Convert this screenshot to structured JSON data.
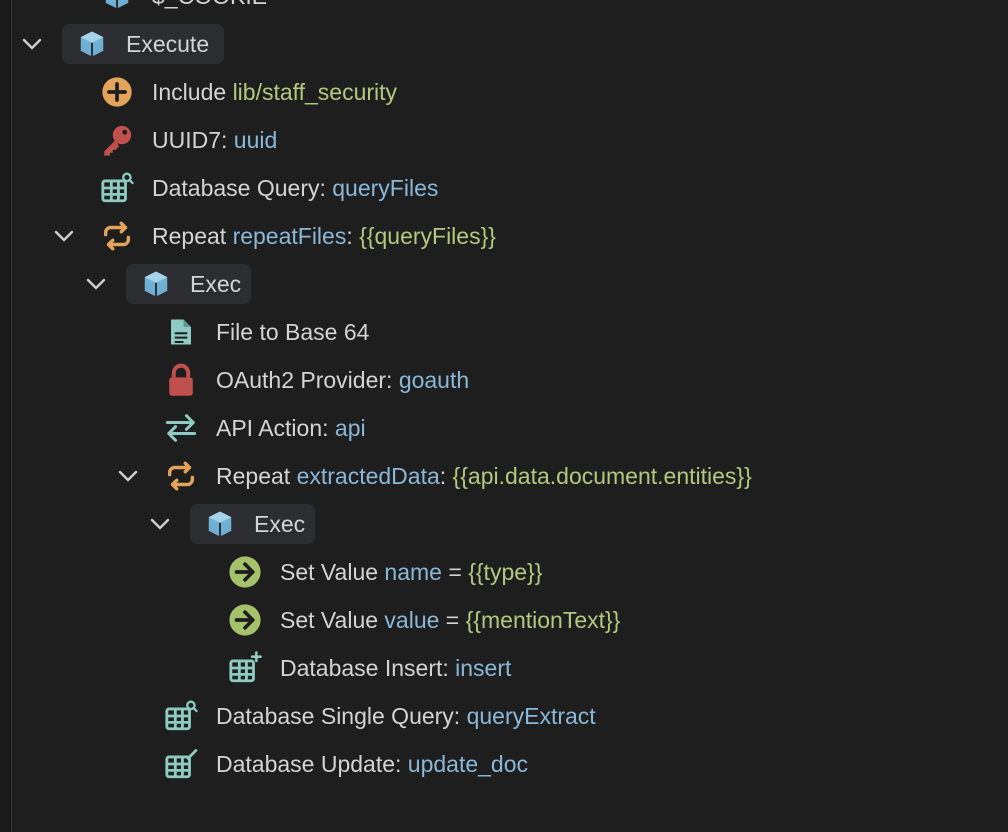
{
  "colors": {
    "background": "#1e1e1f",
    "text": "#d4d4d4",
    "identifier_blue": "#8ab8d8",
    "string_green": "#b3c97e",
    "block_teal": "#6fb0d2",
    "repeat_orange": "#e4a35a",
    "key_red": "#c0504d",
    "arrow_green": "#a5c26b",
    "table_teal": "#8ecbc3"
  },
  "rows": [
    {
      "icon": "cube-icon",
      "text": "$_COOKIE"
    },
    {
      "icon": "cube-icon",
      "label": "Execute"
    },
    {
      "icon": "plus-circle-icon",
      "keyword": "Include",
      "value": "lib/staff_security"
    },
    {
      "icon": "key-icon",
      "keyword": "UUID7:",
      "value": "uuid"
    },
    {
      "icon": "table-search-icon",
      "keyword": "Database Query:",
      "value": "queryFiles"
    },
    {
      "icon": "repeat-icon",
      "keyword": "Repeat",
      "var": "repeatFiles",
      "sep": ":",
      "value": "{{queryFiles}}"
    },
    {
      "icon": "cube-icon",
      "label": "Exec"
    },
    {
      "icon": "file-icon",
      "keyword": "File to Base 64"
    },
    {
      "icon": "lock-icon",
      "keyword": "OAuth2 Provider:",
      "value": "goauth"
    },
    {
      "icon": "swap-arrows-icon",
      "keyword": "API Action:",
      "value": "api"
    },
    {
      "icon": "repeat-icon",
      "keyword": "Repeat",
      "var": "extractedData",
      "sep": ":",
      "value": "{{api.data.document.entities}}"
    },
    {
      "icon": "cube-icon",
      "label": "Exec"
    },
    {
      "icon": "arrow-right-circle-icon",
      "keyword": "Set Value",
      "var": "name",
      "sep": "=",
      "value": "{{type}}"
    },
    {
      "icon": "arrow-right-circle-icon",
      "keyword": "Set Value",
      "var": "value",
      "sep": "=",
      "value": "{{mentionText}}"
    },
    {
      "icon": "table-plus-icon",
      "keyword": "Database Insert:",
      "value": "insert"
    },
    {
      "icon": "table-search-icon",
      "keyword": "Database Single Query:",
      "value": "queryExtract"
    },
    {
      "icon": "table-edit-icon",
      "keyword": "Database Update:",
      "value": "update_doc"
    }
  ]
}
